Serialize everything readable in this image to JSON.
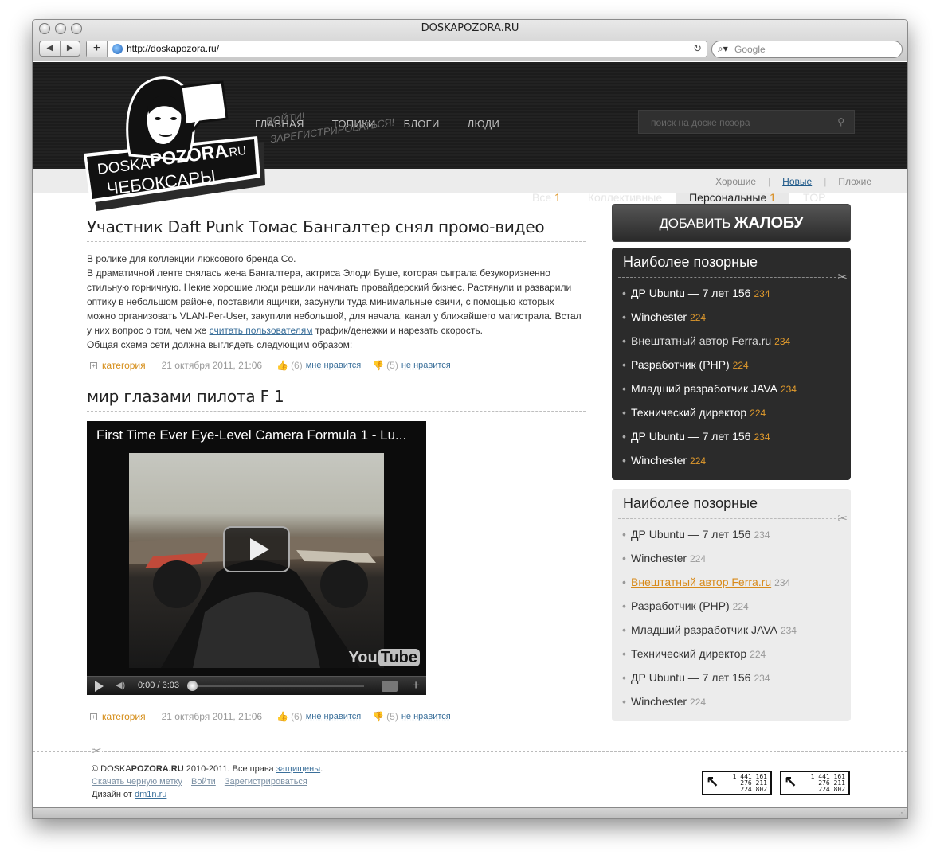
{
  "browser": {
    "title": "DOSKAPOZORA.RU",
    "url": "http://doskapozora.ru/",
    "search_placeholder": "Google",
    "back": "◀",
    "forward": "▶",
    "add_tab": "+",
    "reload": "↻"
  },
  "header": {
    "logo_text_1": "DOSKA",
    "logo_text_2": "POZORA",
    "logo_text_3": ".RU",
    "logo_city": "ЧЕБОКСАРЫ",
    "nav": [
      "ГЛАВНАЯ",
      "ТОПИКИ",
      "БЛОГИ",
      "ЛЮДИ"
    ],
    "search_placeholder": "поиск на доске позора",
    "login": "ВОЙТИ!",
    "register": "ЗАРЕГИСТРИРОВАТЬСЯ!",
    "tabs": [
      {
        "label": "Все",
        "count": "1"
      },
      {
        "label": "Коллективные",
        "count": ""
      },
      {
        "label": "Персональные",
        "count": "1"
      },
      {
        "label": "TOP",
        "count": ""
      }
    ]
  },
  "subnav": {
    "good": "Хорошие",
    "new": "Новые",
    "bad": "Плохие",
    "sep": "|"
  },
  "posts": [
    {
      "title": "Участник Daft Punk Томас Бангалтер снял промо-видео",
      "line1": "В ролике для коллекции люксового бренда Co.",
      "line2_before": "В драматичной ленте снялась жена Бангалтера, актриса Элоди Буше, которая сыграла безукоризненно стильную горничную. Некие хорошие люди решили начинать провайдерский бизнес. Растянули и разварили оптику в небольшом районе, поставили ящички, засунули туда минимальные свичи, с помощью которых можно организовать VLAN-Per-User, закупили небольшой, для начала, канал у ближайшего магистрала. Встал у них вопрос о том, чем же ",
      "line2_link": "считать пользователям",
      "line2_after": " трафик/денежки и нарезать скорость.",
      "line3": "Общая схема сети должна выглядеть следующим образом:",
      "meta": {
        "category": "категория",
        "date": "21 октября 2011, 21:06",
        "likes": "(6)",
        "like_label": "мне нравится",
        "dislikes": "(5)",
        "dislike_label": "не нравится"
      }
    },
    {
      "title": "мир глазами пилота F 1",
      "video": {
        "title": "First Time Ever Eye-Level Camera Formula 1 - Lu...",
        "time": "0:00 / 3:03",
        "brand_1": "You",
        "brand_2": "Tube"
      },
      "meta": {
        "category": "категория",
        "date": "21 октября 2011, 21:06",
        "likes": "(6)",
        "like_label": "мне нравится",
        "dislikes": "(5)",
        "dislike_label": "не нравится"
      }
    }
  ],
  "sidebar": {
    "add_button_1": "ДОБАВИТЬ",
    "add_button_2": "ЖАЛОБУ",
    "boxes": [
      {
        "title": "Наиболее позорные",
        "items": [
          {
            "name": "ДР Ubuntu — 7 лет 156",
            "count": "234"
          },
          {
            "name": "Winchester",
            "count": "224"
          },
          {
            "name": "Внештатный автор Ferra.ru",
            "count": "234"
          },
          {
            "name": "Разработчик (PHP)",
            "count": "224"
          },
          {
            "name": "Младший разработчик JAVA",
            "count": "234"
          },
          {
            "name": "Технический директор",
            "count": "224"
          },
          {
            "name": "ДР Ubuntu — 7 лет 156",
            "count": "234"
          },
          {
            "name": "Winchester",
            "count": "224"
          }
        ]
      },
      {
        "title": "Наиболее позорные",
        "items": [
          {
            "name": "ДР Ubuntu — 7 лет 156",
            "count": "234"
          },
          {
            "name": "Winchester",
            "count": "224"
          },
          {
            "name": "Внештатный автор Ferra.ru",
            "count": "234"
          },
          {
            "name": "Разработчик (PHP)",
            "count": "224"
          },
          {
            "name": "Младший разработчик JAVA",
            "count": "234"
          },
          {
            "name": "Технический директор",
            "count": "224"
          },
          {
            "name": "ДР Ubuntu — 7 лет 156",
            "count": "234"
          },
          {
            "name": "Winchester",
            "count": "224"
          }
        ]
      }
    ]
  },
  "footer": {
    "copy": "© DOSKA",
    "copy_bold": "POZORA.RU",
    "copy_rest": " 2010-2011. Все права ",
    "rights_link": "защищены",
    "dot": ".",
    "links": [
      "Скачать черную метку",
      "Войти",
      "Зарегистрироваться"
    ],
    "design_by": "Дизайн от ",
    "design_link": "dm1n.ru",
    "counter": [
      "1 441 161",
      "276 211",
      "224 802"
    ]
  },
  "colors": {
    "accent": "#e09a2c",
    "link": "#3a6f9a",
    "dark": "#2b2b2b"
  },
  "icons": [
    "search-icon",
    "globe-icon",
    "reload-icon",
    "thumb-up-icon",
    "thumb-down-icon",
    "scissors-icon",
    "play-icon",
    "plus-icon"
  ]
}
